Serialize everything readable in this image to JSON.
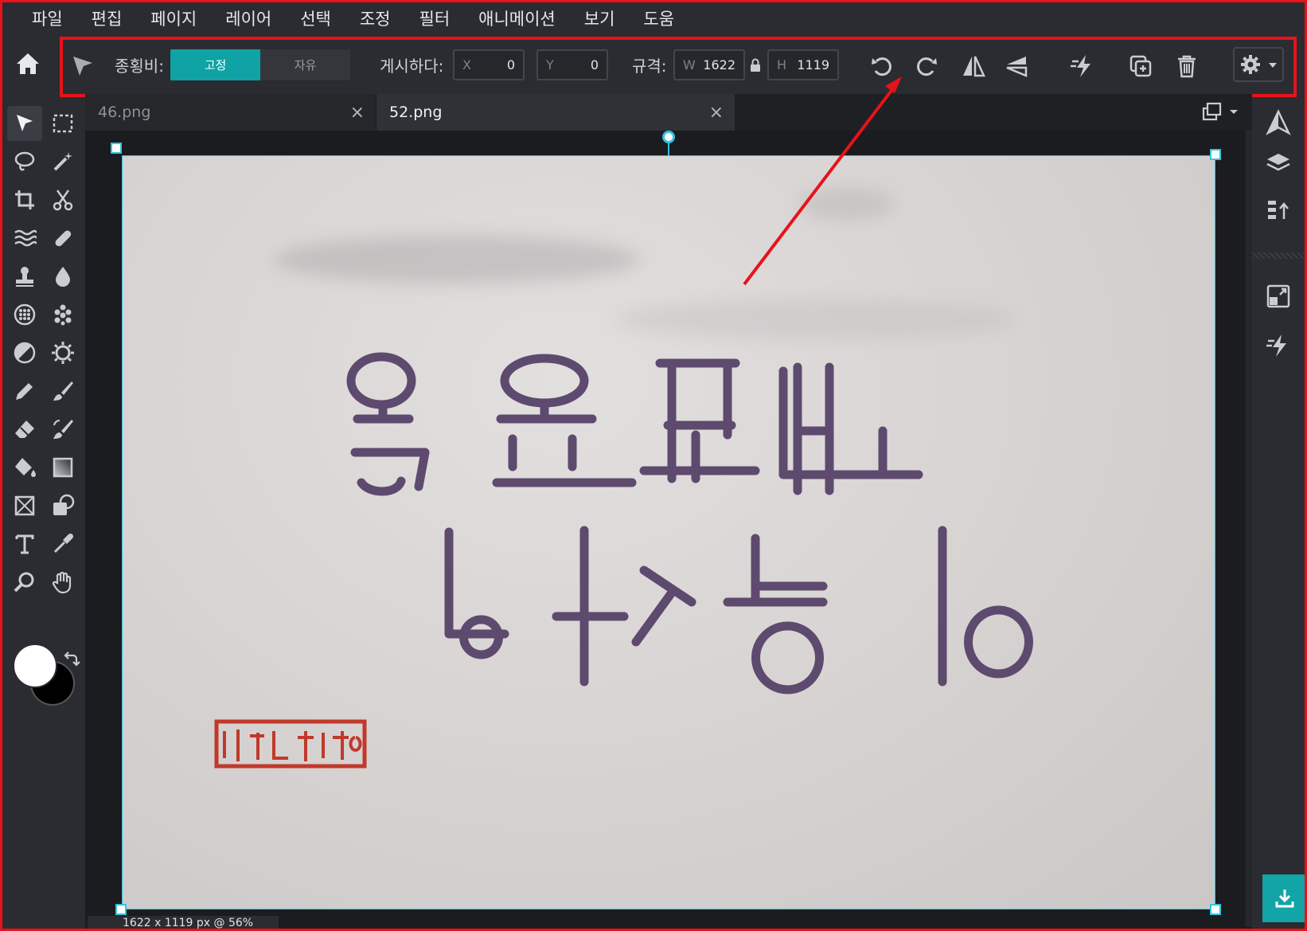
{
  "menu": [
    "파일",
    "편집",
    "페이지",
    "레이어",
    "선택",
    "조정",
    "필터",
    "애니메이션",
    "보기",
    "도움"
  ],
  "toolbar": {
    "aspect_label": "종횡비:",
    "aspect_fixed": "고정",
    "aspect_free": "자유",
    "position_label": "게시하다:",
    "x_prefix": "X",
    "x_value": "0",
    "y_prefix": "Y",
    "y_value": "0",
    "size_label": "규격:",
    "w_prefix": "W",
    "w_value": "1622",
    "h_prefix": "H",
    "h_value": "1119"
  },
  "tabs": [
    {
      "label": "46.png"
    },
    {
      "label": "52.png"
    }
  ],
  "tab_close": "×",
  "status": "1622 x 1119 px @ 56%",
  "colors": {
    "accent": "#0fa3a5",
    "highlight": "#e8121a",
    "selection": "#36c2e0"
  }
}
